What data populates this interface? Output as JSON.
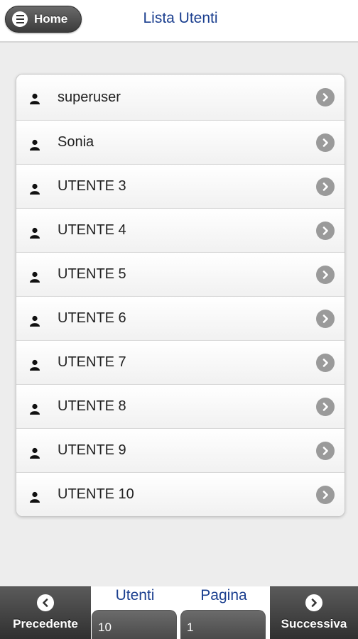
{
  "header": {
    "home_label": "Home",
    "title": "Lista Utenti"
  },
  "users": [
    {
      "label": "superuser"
    },
    {
      "label": "Sonia"
    },
    {
      "label": "UTENTE 3"
    },
    {
      "label": "UTENTE 4"
    },
    {
      "label": "UTENTE 5"
    },
    {
      "label": "UTENTE 6"
    },
    {
      "label": "UTENTE 7"
    },
    {
      "label": "UTENTE 8"
    },
    {
      "label": "UTENTE 9"
    },
    {
      "label": "UTENTE 10"
    }
  ],
  "footer": {
    "prev_label": "Precedente",
    "next_label": "Successiva",
    "utenti_label": "Utenti",
    "utenti_value": "10",
    "pagina_label": "Pagina",
    "pagina_value": "1"
  },
  "icons": {
    "home_menu": "menu-icon",
    "user": "user-icon",
    "row_arrow": "chevron-right-icon",
    "prev": "chevron-left-icon",
    "next": "chevron-right-icon"
  },
  "colors": {
    "title": "#1b3f8f",
    "dark_button": "#3b3b3b",
    "chevron": "#9a9a9a"
  }
}
